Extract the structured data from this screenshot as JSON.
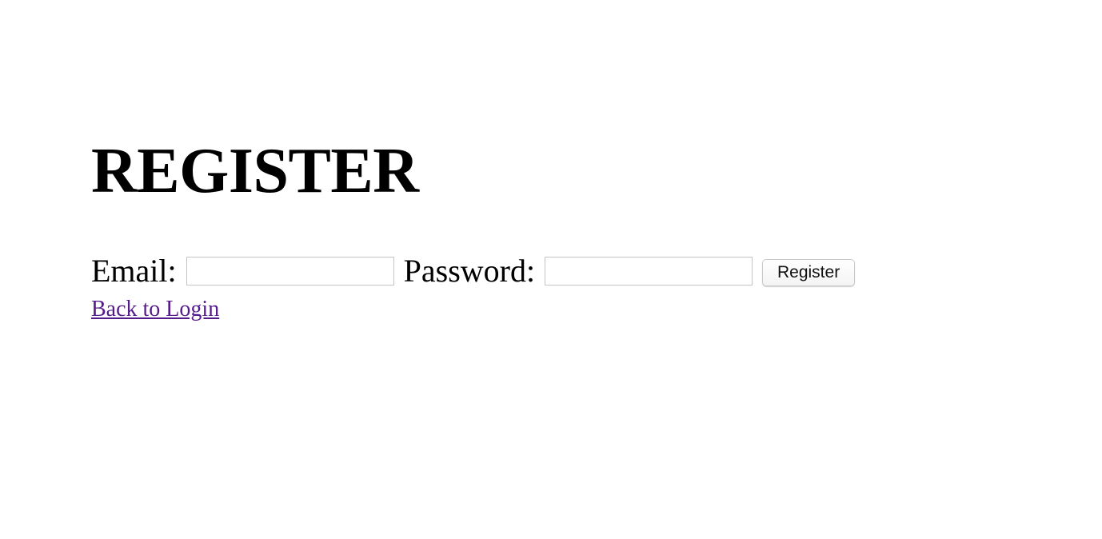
{
  "page": {
    "title": "REGISTER"
  },
  "form": {
    "email_label": "Email:",
    "email_value": "",
    "email_placeholder": "",
    "password_label": "Password:",
    "password_value": "",
    "password_placeholder": "",
    "submit_label": "Register"
  },
  "links": {
    "back_to_login": "Back to Login"
  },
  "colors": {
    "visited_link": "#551a8b",
    "text": "#000000",
    "input_border": "#c4c4c4",
    "background": "#ffffff"
  }
}
